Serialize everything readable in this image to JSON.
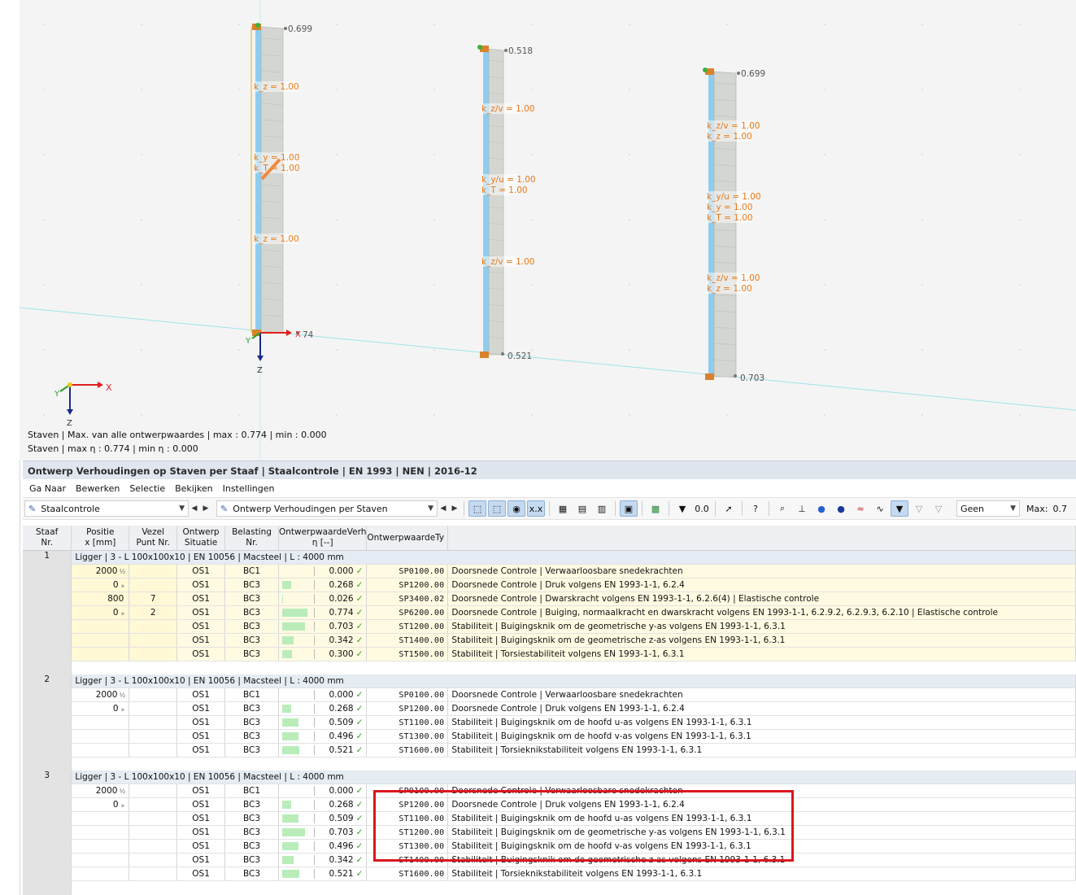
{
  "viewport": {
    "columns": [
      {
        "top_value": "0.699",
        "bottom_value": "74",
        "labels": [
          [
            "k_z = 1.00"
          ],
          [
            "k_y = 1.00",
            "k_T = 1.00"
          ],
          [
            "k_z = 1.00"
          ]
        ]
      },
      {
        "top_value": "0.518",
        "bottom_value": "0.521",
        "labels": [
          [
            "k_z/v = 1.00"
          ],
          [
            "k_y/u = 1.00",
            "k_T = 1.00"
          ],
          [
            "k_z/v = 1.00"
          ]
        ]
      },
      {
        "top_value": "0.699",
        "bottom_value": "0.703",
        "labels": [
          [
            "k_z/v = 1.00",
            "k_z = 1.00"
          ],
          [
            "k_y/u = 1.00",
            "k_y = 1.00",
            "k_T = 1.00"
          ],
          [
            "k_z/v = 1.00",
            "k_z = 1.00"
          ]
        ]
      }
    ],
    "axis_labels": {
      "x": "X",
      "y": "Y",
      "z": "Z",
      "local_x": "X",
      "local_y": "Y",
      "local_z": "Z"
    },
    "status_line1": "Staven | Max. van alle ontwerpwaardes | max  : 0.774 | min  : 0.000",
    "status_line2": "Staven | max η : 0.774 | min η : 0.000"
  },
  "panel": {
    "title": "Ontwerp Verhoudingen op Staven per Staaf | Staalcontrole | EN 1993 | NEN | 2016-12",
    "menu": [
      "Ga Naar",
      "Bewerken",
      "Selectie",
      "Bekijken",
      "Instellingen"
    ],
    "combo_module": "Staalcontrole",
    "combo_view": "Ontwerp Verhoudingen per Staven",
    "combo_filter": "Geen",
    "max_label": "Max:",
    "max_value": "0.7"
  },
  "table": {
    "headers": {
      "staaf": [
        "Staaf",
        "Nr."
      ],
      "positie": [
        "Positie",
        "x [mm]"
      ],
      "vezel": [
        "Vezel",
        "Punt Nr."
      ],
      "situatie": [
        "Ontwerp",
        "Situatie"
      ],
      "belasting": [
        "Belasting",
        "Nr."
      ],
      "ratio": [
        "OntwerpwaardeVerh",
        "η [--]"
      ],
      "type": [
        "OntwerpwaardeTy",
        ""
      ]
    },
    "groups": [
      {
        "nr": "1",
        "header": "Ligger | 3 - L 100x100x10 | EN 10056 | Macsteel | L : 4000 mm",
        "rows": [
          {
            "pos": "2000",
            "pos_sym": "½",
            "vez": "",
            "sit": "OS1",
            "bel": "BC1",
            "ratio": 0.0,
            "ratio_text": "0.000",
            "code": "SP0100.00",
            "desc": "Doorsnede Controle | Verwaarloosbare snedekrachten"
          },
          {
            "pos": "0",
            "pos_sym": "⌅",
            "vez": "",
            "sit": "OS1",
            "bel": "BC3",
            "ratio": 0.268,
            "ratio_text": "0.268",
            "code": "SP1200.00",
            "desc": "Doorsnede Controle | Druk volgens EN 1993-1-1, 6.2.4"
          },
          {
            "pos": "800",
            "pos_sym": "",
            "vez": "7",
            "sit": "OS1",
            "bel": "BC3",
            "ratio": 0.026,
            "ratio_text": "0.026",
            "code": "SP3400.02",
            "desc": "Doorsnede Controle | Dwarskracht volgens EN 1993-1-1, 6.2.6(4) | Elastische controle"
          },
          {
            "pos": "0",
            "pos_sym": "⌅",
            "vez": "2",
            "sit": "OS1",
            "bel": "BC3",
            "ratio": 0.774,
            "ratio_text": "0.774",
            "code": "SP6200.00",
            "desc": "Doorsnede Controle | Buiging, normaalkracht en dwarskracht volgens EN 1993-1-1, 6.2.9.2, 6.2.9.3, 6.2.10 | Elastische controle"
          },
          {
            "pos": "",
            "pos_sym": "",
            "vez": "",
            "sit": "OS1",
            "bel": "BC3",
            "ratio": 0.703,
            "ratio_text": "0.703",
            "code": "ST1200.00",
            "desc": "Stabiliteit | Buigingsknik om de geometrische y-as volgens EN 1993-1-1, 6.3.1"
          },
          {
            "pos": "",
            "pos_sym": "",
            "vez": "",
            "sit": "OS1",
            "bel": "BC3",
            "ratio": 0.342,
            "ratio_text": "0.342",
            "code": "ST1400.00",
            "desc": "Stabiliteit | Buigingsknik om de geometrische z-as volgens EN 1993-1-1, 6.3.1"
          },
          {
            "pos": "",
            "pos_sym": "",
            "vez": "",
            "sit": "OS1",
            "bel": "BC3",
            "ratio": 0.3,
            "ratio_text": "0.300",
            "code": "ST1500.00",
            "desc": "Stabiliteit | Torsiestabiliteit volgens EN 1993-1-1, 6.3.1"
          }
        ]
      },
      {
        "nr": "2",
        "header": "Ligger | 3 - L 100x100x10 | EN 10056 | Macsteel | L : 4000 mm",
        "rows": [
          {
            "pos": "2000",
            "pos_sym": "½",
            "vez": "",
            "sit": "OS1",
            "bel": "BC1",
            "ratio": 0.0,
            "ratio_text": "0.000",
            "code": "SP0100.00",
            "desc": "Doorsnede Controle | Verwaarloosbare snedekrachten"
          },
          {
            "pos": "0",
            "pos_sym": "⌅",
            "vez": "",
            "sit": "OS1",
            "bel": "BC3",
            "ratio": 0.268,
            "ratio_text": "0.268",
            "code": "SP1200.00",
            "desc": "Doorsnede Controle | Druk volgens EN 1993-1-1, 6.2.4"
          },
          {
            "pos": "",
            "pos_sym": "",
            "vez": "",
            "sit": "OS1",
            "bel": "BC3",
            "ratio": 0.509,
            "ratio_text": "0.509",
            "code": "ST1100.00",
            "desc": "Stabiliteit | Buigingsknik om de hoofd u-as volgens EN 1993-1-1, 6.3.1"
          },
          {
            "pos": "",
            "pos_sym": "",
            "vez": "",
            "sit": "OS1",
            "bel": "BC3",
            "ratio": 0.496,
            "ratio_text": "0.496",
            "code": "ST1300.00",
            "desc": "Stabiliteit | Buigingsknik om de hoofd v-as volgens EN 1993-1-1, 6.3.1"
          },
          {
            "pos": "",
            "pos_sym": "",
            "vez": "",
            "sit": "OS1",
            "bel": "BC3",
            "ratio": 0.521,
            "ratio_text": "0.521",
            "code": "ST1600.00",
            "desc": "Stabiliteit | Torsieknikstabiliteit volgens EN 1993-1-1, 6.3.1"
          }
        ]
      },
      {
        "nr": "3",
        "header": "Ligger | 3 - L 100x100x10 | EN 10056 | Macsteel | L : 4000 mm",
        "rows": [
          {
            "pos": "2000",
            "pos_sym": "½",
            "vez": "",
            "sit": "OS1",
            "bel": "BC1",
            "ratio": 0.0,
            "ratio_text": "0.000",
            "code": "SP0100.00",
            "desc": "Doorsnede Controle | Verwaarloosbare snedekrachten"
          },
          {
            "pos": "0",
            "pos_sym": "⌅",
            "vez": "",
            "sit": "OS1",
            "bel": "BC3",
            "ratio": 0.268,
            "ratio_text": "0.268",
            "code": "SP1200.00",
            "desc": "Doorsnede Controle | Druk volgens EN 1993-1-1, 6.2.4"
          },
          {
            "pos": "",
            "pos_sym": "",
            "vez": "",
            "sit": "OS1",
            "bel": "BC3",
            "ratio": 0.509,
            "ratio_text": "0.509",
            "code": "ST1100.00",
            "desc": "Stabiliteit | Buigingsknik om de hoofd u-as volgens EN 1993-1-1, 6.3.1"
          },
          {
            "pos": "",
            "pos_sym": "",
            "vez": "",
            "sit": "OS1",
            "bel": "BC3",
            "ratio": 0.703,
            "ratio_text": "0.703",
            "code": "ST1200.00",
            "desc": "Stabiliteit | Buigingsknik om de geometrische y-as volgens EN 1993-1-1, 6.3.1"
          },
          {
            "pos": "",
            "pos_sym": "",
            "vez": "",
            "sit": "OS1",
            "bel": "BC3",
            "ratio": 0.496,
            "ratio_text": "0.496",
            "code": "ST1300.00",
            "desc": "Stabiliteit | Buigingsknik om de hoofd v-as volgens EN 1993-1-1, 6.3.1"
          },
          {
            "pos": "",
            "pos_sym": "",
            "vez": "",
            "sit": "OS1",
            "bel": "BC3",
            "ratio": 0.342,
            "ratio_text": "0.342",
            "code": "ST1400.00",
            "desc": "Stabiliteit | Buigingsknik om de geometrische z-as volgens EN 1993-1-1, 6.3.1"
          },
          {
            "pos": "",
            "pos_sym": "",
            "vez": "",
            "sit": "OS1",
            "bel": "BC3",
            "ratio": 0.521,
            "ratio_text": "0.521",
            "code": "ST1600.00",
            "desc": "Stabiliteit | Torsieknikstabiliteit volgens EN 1993-1-1, 6.3.1"
          }
        ]
      }
    ]
  },
  "colors": {
    "accent_orange": "#e87a18",
    "bar_green": "#b9ecb9",
    "highlight_red": "#d9171e",
    "member_blue": "#8ecdf0"
  }
}
